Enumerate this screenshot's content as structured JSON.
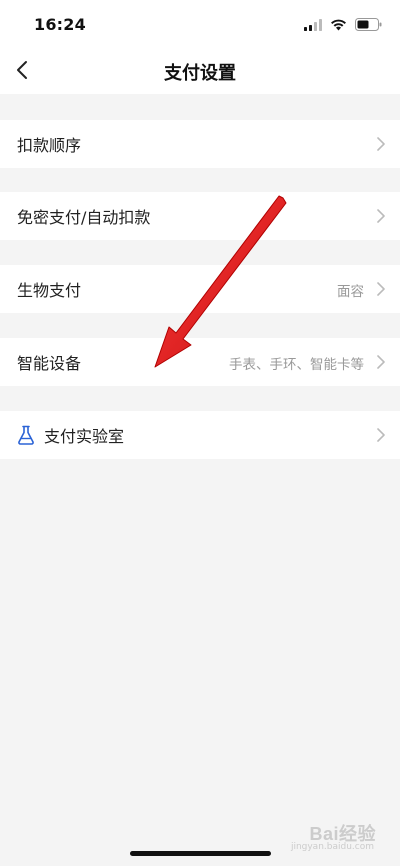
{
  "status_bar": {
    "time": "16:24",
    "icons": [
      "cellular-signal-icon",
      "wifi-icon",
      "battery-icon"
    ]
  },
  "nav": {
    "title": "支付设置",
    "back_icon": "chevron-left-icon"
  },
  "settings": {
    "items": [
      {
        "label": "扣款顺序",
        "value": ""
      },
      {
        "label": "免密支付/自动扣款",
        "value": ""
      },
      {
        "label": "生物支付",
        "value": "面容"
      },
      {
        "label": "智能设备",
        "value": "手表、手环、智能卡等"
      },
      {
        "label": "支付实验室",
        "value": "",
        "icon": "flask-icon"
      }
    ]
  },
  "colors": {
    "background": "#f4f4f4",
    "row": "#ffffff",
    "text_primary": "#222222",
    "text_secondary": "#999999",
    "flask_icon": "#2b63d6",
    "annotation_arrow": "#e01e1e"
  },
  "watermark": {
    "text": "Bai经验",
    "sub": "jingyan.baidu.com"
  }
}
